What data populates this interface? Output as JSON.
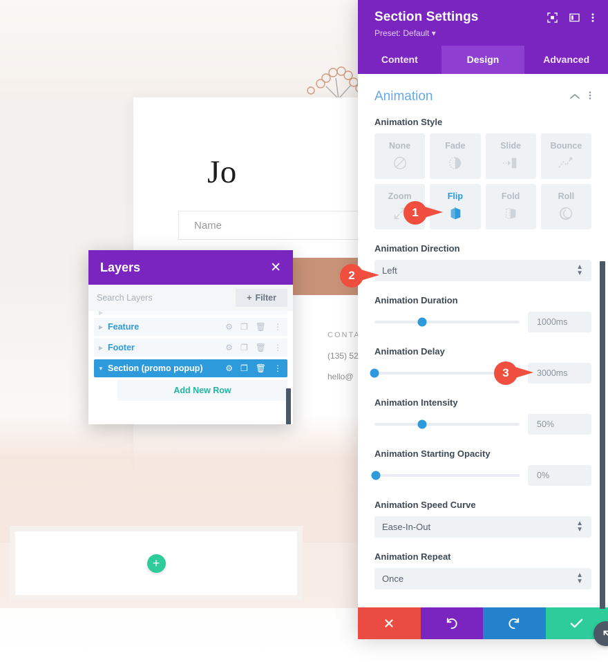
{
  "background_page": {
    "title": "Jo",
    "name_input_placeholder": "Name",
    "contact_label": "CONTA",
    "contact_phone": "(135) 52",
    "contact_email": "hello@",
    "add_module_icon": "plus-icon"
  },
  "layers_panel": {
    "title": "Layers",
    "close_icon": "close-icon",
    "search_placeholder": "Search Layers",
    "filter_label": "Filter",
    "filter_icon": "plus-icon",
    "add_new_row_label": "Add New Row",
    "rows": [
      {
        "name": "Feature",
        "selected": false,
        "expand_icon": "chevron-right-icon"
      },
      {
        "name": "Footer",
        "selected": false,
        "expand_icon": "chevron-right-icon"
      },
      {
        "name": "Section (promo popup)",
        "selected": true,
        "expand_icon": "chevron-down-icon"
      }
    ],
    "row_icons": [
      "gear-icon",
      "duplicate-icon",
      "trash-icon",
      "more-vertical-icon"
    ]
  },
  "settings_modal": {
    "title": "Section Settings",
    "preset_label": "Preset: Default",
    "preset_caret": "▾",
    "header_icons": [
      "focus-target-icon",
      "layout-panel-icon",
      "more-vertical-icon"
    ],
    "tabs": [
      {
        "label": "Content",
        "active": false
      },
      {
        "label": "Design",
        "active": true
      },
      {
        "label": "Advanced",
        "active": false
      }
    ],
    "section": {
      "title": "Animation",
      "collapse_icon": "chevron-up-icon",
      "menu_icon": "more-vertical-icon"
    },
    "animation_style": {
      "label": "Animation Style",
      "options": [
        {
          "name": "None",
          "icon": "no-entry-icon",
          "active": false
        },
        {
          "name": "Fade",
          "icon": "fade-icon",
          "active": false
        },
        {
          "name": "Slide",
          "icon": "slide-icon",
          "active": false
        },
        {
          "name": "Bounce",
          "icon": "bounce-icon",
          "active": false
        },
        {
          "name": "Zoom",
          "icon": "zoom-icon",
          "active": false
        },
        {
          "name": "Flip",
          "icon": "flip-icon",
          "active": true
        },
        {
          "name": "Fold",
          "icon": "fold-icon",
          "active": false
        },
        {
          "name": "Roll",
          "icon": "roll-icon",
          "active": false
        }
      ]
    },
    "fields": {
      "direction": {
        "label": "Animation Direction",
        "value": "Left"
      },
      "duration": {
        "label": "Animation Duration",
        "value": "1000ms",
        "slider_pct": 33
      },
      "delay": {
        "label": "Animation Delay",
        "value": "3000ms",
        "slider_pct": 0
      },
      "intensity": {
        "label": "Animation Intensity",
        "value": "50%",
        "slider_pct": 33
      },
      "start_opacity": {
        "label": "Animation Starting Opacity",
        "value": "0%",
        "slider_pct": 0
      },
      "speed_curve": {
        "label": "Animation Speed Curve",
        "value": "Ease-In-Out"
      },
      "repeat": {
        "label": "Animation Repeat",
        "value": "Once"
      }
    },
    "actions": [
      {
        "name": "cancel",
        "icon": "close-icon",
        "color": "#eb4c42"
      },
      {
        "name": "undo",
        "icon": "undo-icon",
        "color": "#7b25c1"
      },
      {
        "name": "redo",
        "icon": "redo-icon",
        "color": "#2481cc"
      },
      {
        "name": "save",
        "icon": "check-icon",
        "color": "#2ecc9b"
      }
    ]
  },
  "callouts": [
    {
      "number": "1"
    },
    {
      "number": "2"
    },
    {
      "number": "3"
    }
  ],
  "colors": {
    "brand_purple": "#7b25c1",
    "tab_active_purple": "#8e3fd1",
    "accent_blue": "#2c9adb",
    "section_title_blue": "#63a9e8",
    "callout_red": "#f04e3e",
    "save_green": "#2ecc9b",
    "scrollbar_dark": "#4c5866"
  }
}
